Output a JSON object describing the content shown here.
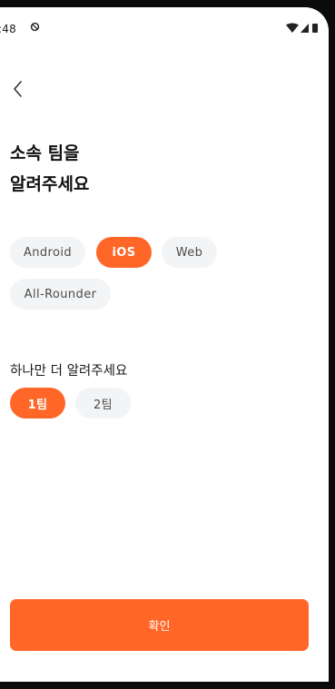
{
  "status_bar": {
    "time": ":48"
  },
  "header": {
    "back_icon": "chevron-left-icon"
  },
  "title": {
    "line1": "소속 팀을",
    "line2": "알려주세요"
  },
  "team_chips": [
    {
      "label": "Android",
      "selected": false
    },
    {
      "label": "iOS",
      "selected": true
    },
    {
      "label": "Web",
      "selected": false
    },
    {
      "label": "All-Rounder",
      "selected": false
    }
  ],
  "sub_section": {
    "label": "하나만 더 알려주세요",
    "options": [
      {
        "label": "1팀",
        "selected": true
      },
      {
        "label": "2팀",
        "selected": false
      }
    ]
  },
  "confirm_button": {
    "label": "확인"
  },
  "colors": {
    "accent": "#ff6628",
    "chip_bg": "#f3f4f6",
    "chip_text": "#4b4b4b"
  }
}
